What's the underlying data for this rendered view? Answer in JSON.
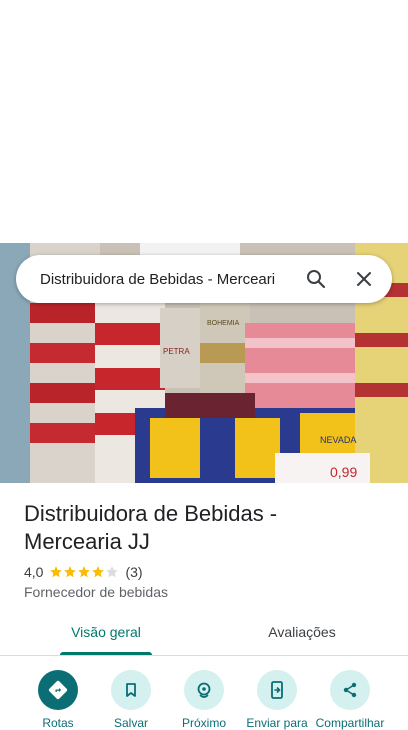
{
  "search": {
    "query": "Distribuidora de Bebidas - Merceari"
  },
  "place": {
    "name_line1": "Distribuidora de Bebidas -",
    "name_line2": "Mercearia JJ",
    "rating": "4,0",
    "rating_stars": 4,
    "review_count": "(3)",
    "category": "Fornecedor de bebidas"
  },
  "photo_text": {
    "brand1": "PETRA",
    "brand2": "BOHEMIA",
    "can_label": "NEVADA",
    "price": "0,99"
  },
  "tabs": [
    {
      "label": "Visão geral",
      "active": true
    },
    {
      "label": "Avaliações",
      "active": false
    }
  ],
  "actions": [
    {
      "label": "Rotas",
      "icon": "directions-icon"
    },
    {
      "label": "Salvar",
      "icon": "bookmark-icon"
    },
    {
      "label": "Próximo",
      "icon": "nearby-icon"
    },
    {
      "label": "Enviar para",
      "icon": "send-to-phone-icon"
    },
    {
      "label": "Compartilhar",
      "icon": "share-icon"
    }
  ],
  "colors": {
    "accent": "#00796b",
    "action_primary": "#0b6e75",
    "action_secondary_bg": "#d4f0ef",
    "star": "#fbbc04"
  }
}
